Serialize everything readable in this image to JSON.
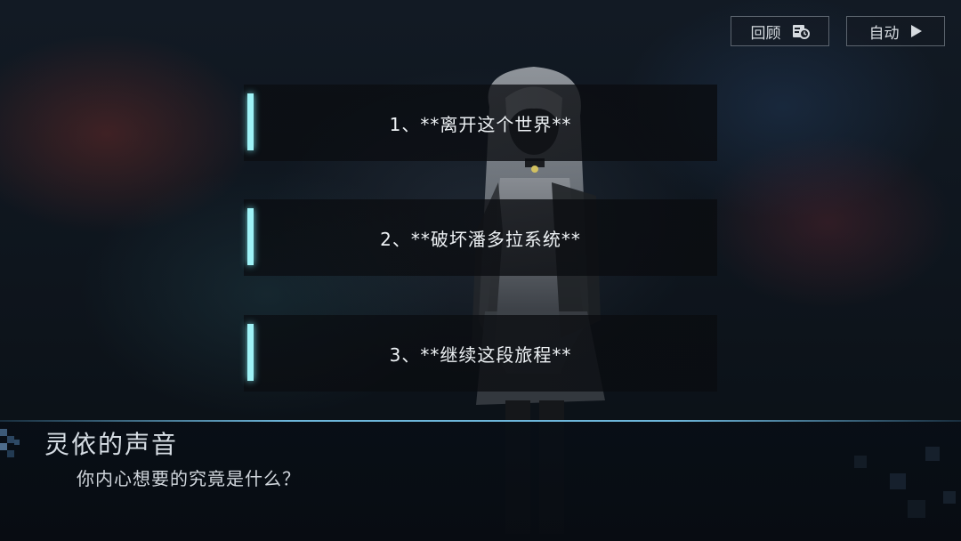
{
  "top_bar": {
    "review_label": "回顾",
    "review_icon": "log-icon",
    "auto_label": "自动",
    "auto_icon": "play-icon"
  },
  "choices": [
    {
      "label": "1、**离开这个世界**"
    },
    {
      "label": "2、**破坏潘多拉系统**"
    },
    {
      "label": "3、**继续这段旅程**"
    }
  ],
  "dialog": {
    "speaker": "灵依的声音",
    "text": "你内心想要的究竟是什么？"
  },
  "colors": {
    "accent": "#9ff3f7",
    "dialog_line": "#78c8f0",
    "text": "#eef2f5"
  }
}
